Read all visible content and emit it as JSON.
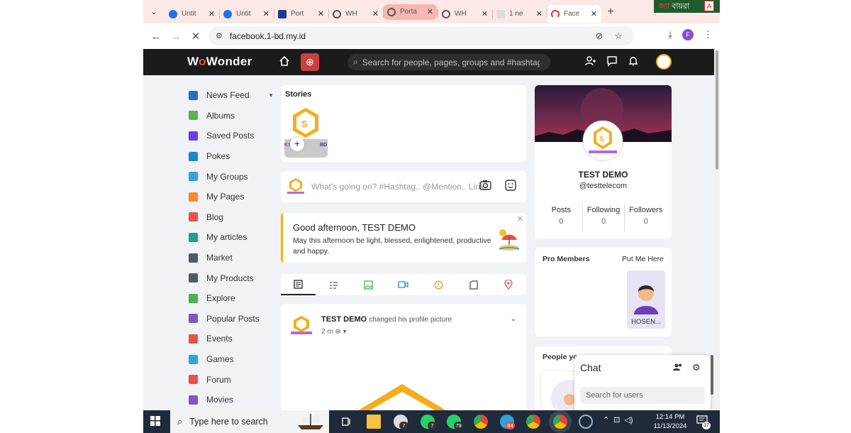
{
  "browser": {
    "tabs": [
      {
        "title": "Untit",
        "favicon_color": "#1a73e8"
      },
      {
        "title": "Untit",
        "favicon_color": "#1a73e8"
      },
      {
        "title": "Port",
        "favicon_color": "#1b3a8c"
      },
      {
        "title": "WH",
        "favicon_color": "#555555"
      },
      {
        "title": "Porta",
        "favicon_color": "#555555"
      },
      {
        "title": "WH",
        "favicon_color": "#555555"
      },
      {
        "title": "1 ne",
        "favicon_color": "#cccccc"
      },
      {
        "title": "Face",
        "favicon_color": "#d93025"
      }
    ],
    "url": "facebook.1-bd.my.id",
    "profile_letter": "F",
    "overlay_text": {
      "red": "জ্যা",
      "rest": "বায়রা"
    }
  },
  "site": {
    "logo": {
      "w": "W",
      "o": "o",
      "rest": "Wonder"
    },
    "search_placeholder": "Search for people, pages, groups and #hashtags"
  },
  "sidebar": {
    "items": [
      {
        "label": "News Feed",
        "icon": "home-icon",
        "color": "#2b6cc4"
      },
      {
        "label": "Albums",
        "icon": "albums-icon",
        "color": "#5ab05a"
      },
      {
        "label": "Saved Posts",
        "icon": "bookmark-icon",
        "color": "#6a3de8"
      },
      {
        "label": "Pokes",
        "icon": "poke-icon",
        "color": "#1e88c9"
      },
      {
        "label": "My Groups",
        "icon": "groups-icon",
        "color": "#3fa0d8"
      },
      {
        "label": "My Pages",
        "icon": "flag-icon",
        "color": "#f28c28"
      },
      {
        "label": "Blog",
        "icon": "blog-icon",
        "color": "#e5534b"
      },
      {
        "label": "My articles",
        "icon": "article-icon",
        "color": "#22a08a"
      },
      {
        "label": "Market",
        "icon": "market-icon",
        "color": "#4f5a66"
      },
      {
        "label": "My Products",
        "icon": "products-icon",
        "color": "#4f5a66"
      },
      {
        "label": "Explore",
        "icon": "explore-icon",
        "color": "#4caf50"
      },
      {
        "label": "Popular Posts",
        "icon": "popular-icon",
        "color": "#7e57c2"
      },
      {
        "label": "Events",
        "icon": "events-icon",
        "color": "#e5534b"
      },
      {
        "label": "Games",
        "icon": "games-icon",
        "color": "#29a8e0"
      },
      {
        "label": "Forum",
        "icon": "forum-icon",
        "color": "#e5534b"
      },
      {
        "label": "Movies",
        "icon": "movies-icon",
        "color": "#7e57c2"
      }
    ]
  },
  "stories": {
    "title": "Stories",
    "add": "+",
    "brand_left": "KS",
    "brand_right": "BD"
  },
  "publisher": {
    "placeholder": "What's going on? #Hashtag.. @Mention.. Link.."
  },
  "greeting": {
    "title": "Good afternoon, TEST DEMO",
    "subtitle": "May this afternoon be light, blessed, enlightened, productive and happy."
  },
  "post": {
    "author": "TEST DEMO",
    "action": "changed his profile picture",
    "time": "2 m"
  },
  "profile": {
    "name": "TEST DEMO",
    "username": "@testtelecom",
    "stats": [
      {
        "label": "Posts",
        "value": "0"
      },
      {
        "label": "Following",
        "value": "0"
      },
      {
        "label": "Followers",
        "value": "0"
      }
    ]
  },
  "pro_members": {
    "title": "Pro Members",
    "action": "Put Me Here",
    "member_name": "HOSEN..."
  },
  "people": {
    "title": "People yo"
  },
  "chat": {
    "title": "Chat",
    "search_placeholder": "Search for users"
  },
  "taskbar": {
    "search_placeholder": "Type here to search",
    "badges": {
      "whatsapp1": "7",
      "whatsapp2": "79",
      "telegram": "84"
    },
    "time": "12:14 PM",
    "date": "11/13/2024",
    "notification_count": "17"
  }
}
